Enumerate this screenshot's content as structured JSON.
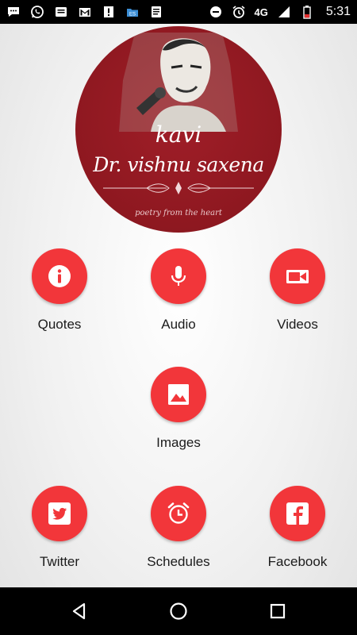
{
  "status_bar": {
    "network": "4G",
    "time": "5:31",
    "left_icons": [
      "chat-icon",
      "whatsapp-icon",
      "sms-icon",
      "gmail-icon",
      "alert-icon",
      "es-file-icon",
      "notes-icon"
    ],
    "right_icons": [
      "do-not-disturb-icon",
      "alarm-icon",
      "signal-icon",
      "battery-icon"
    ]
  },
  "logo": {
    "kavi": "kavi",
    "name": "Dr. vishnu saxena",
    "tagline": "poetry from the heart"
  },
  "menu": {
    "quotes": "Quotes",
    "audio": "Audio",
    "videos": "Videos",
    "images": "Images",
    "twitter": "Twitter",
    "schedules": "Schedules",
    "facebook": "Facebook"
  },
  "colors": {
    "accent": "#f2363a",
    "logo_bg": "#8e1820",
    "status_bar": "#000000"
  }
}
